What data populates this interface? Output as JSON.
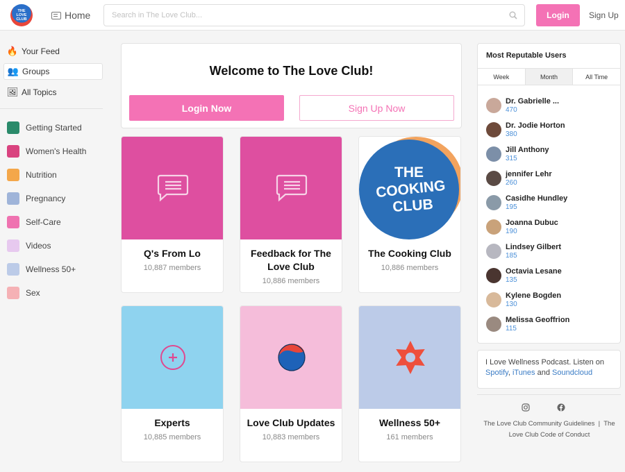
{
  "header": {
    "logo_text": "THE LOVE CLUB",
    "home_label": "Home",
    "search_placeholder": "Search in The Love Club...",
    "login_label": "Login",
    "signup_label": "Sign Up"
  },
  "sidebar": {
    "nav": [
      {
        "label": "Your Feed",
        "icon": "🔥"
      },
      {
        "label": "Groups",
        "icon": "👥"
      },
      {
        "label": "All Topics",
        "icon": "🖼"
      }
    ],
    "topics": [
      {
        "label": "Getting Started",
        "color": "#2a8a6a"
      },
      {
        "label": "Women's Health",
        "color": "#d9437f"
      },
      {
        "label": "Nutrition",
        "color": "#f4a74a"
      },
      {
        "label": "Pregnancy",
        "color": "#9fb4d9"
      },
      {
        "label": "Self-Care",
        "color": "#ef72b0"
      },
      {
        "label": "Videos",
        "color": "#e7c9ef"
      },
      {
        "label": "Wellness 50+",
        "color": "#bccbe8"
      },
      {
        "label": "Sex",
        "color": "#f5b1b5"
      }
    ]
  },
  "welcome": {
    "title": "Welcome to The Love Club!",
    "login_now": "Login Now",
    "signup_now": "Sign Up Now"
  },
  "groups": [
    {
      "name": "Q's From Lo",
      "members": "10,887 members",
      "bg": "#de4fa0",
      "icon": "chat-icon"
    },
    {
      "name": "Feedback for The Love Club",
      "members": "10,886 members",
      "bg": "#de4fa0",
      "icon": "chat-icon"
    },
    {
      "name": "The Cooking Club",
      "members": "10,886 members",
      "bg": "#ffffff",
      "icon": "cooking-club-logo",
      "logo_text": "THE COOKING CLUB"
    },
    {
      "name": "Experts",
      "members": "10,885 members",
      "bg": "#8fd3ef",
      "icon": "plus-circle-icon"
    },
    {
      "name": "Love Club Updates",
      "members": "10,883 members",
      "bg": "#f5bdda",
      "icon": "globe-icon"
    },
    {
      "name": "Wellness 50+",
      "members": "161 members",
      "bg": "#bccbe8",
      "icon": "flower-icon"
    }
  ],
  "reputable": {
    "title": "Most Reputable Users",
    "tabs": [
      "Week",
      "Month",
      "All Time"
    ],
    "active_tab": "Month",
    "users": [
      {
        "name": "Dr. Gabrielle ...",
        "score": "470",
        "avatar": "#c9a89a"
      },
      {
        "name": "Dr. Jodie Horton",
        "score": "380",
        "avatar": "#6e4a3a"
      },
      {
        "name": "Jill Anthony",
        "score": "315",
        "avatar": "#7c8fa8"
      },
      {
        "name": "jennifer Lehr",
        "score": "260",
        "avatar": "#5a4a44"
      },
      {
        "name": "Casidhe Hundley",
        "score": "195",
        "avatar": "#8a9aa8"
      },
      {
        "name": "Joanna Dubuc",
        "score": "190",
        "avatar": "#c9a27a"
      },
      {
        "name": "Lindsey Gilbert",
        "score": "185",
        "avatar": "#b7b7c0"
      },
      {
        "name": "Octavia Lesane",
        "score": "135",
        "avatar": "#4a3530"
      },
      {
        "name": "Kylene Bogden",
        "score": "130",
        "avatar": "#d8b99a"
      },
      {
        "name": "Melissa Geoffrion",
        "score": "115",
        "avatar": "#9a8a80"
      }
    ]
  },
  "podcast": {
    "text": "I Love Wellness Podcast. Listen on",
    "spotify": "Spotify",
    "itunes": "iTunes",
    "and": "and",
    "soundcloud": "Soundcloud"
  },
  "footer": {
    "guidelines": "The Love Club Community Guidelines",
    "separator": "|",
    "conduct": "The Love Club Code of Conduct"
  }
}
